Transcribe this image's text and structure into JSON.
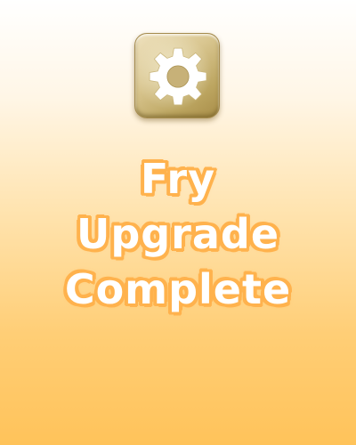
{
  "app_icon": {
    "icon": "gear-icon",
    "tile_color": "#cdb87a",
    "gear_color": "#ffffff"
  },
  "message": {
    "lines": [
      "Fry",
      "Upgrade",
      "Complete"
    ],
    "text_color": "#ffffff",
    "outline_color": "#ffb24d"
  },
  "background": {
    "top_color": "#ffffff",
    "bottom_color": "#ffc35a"
  }
}
